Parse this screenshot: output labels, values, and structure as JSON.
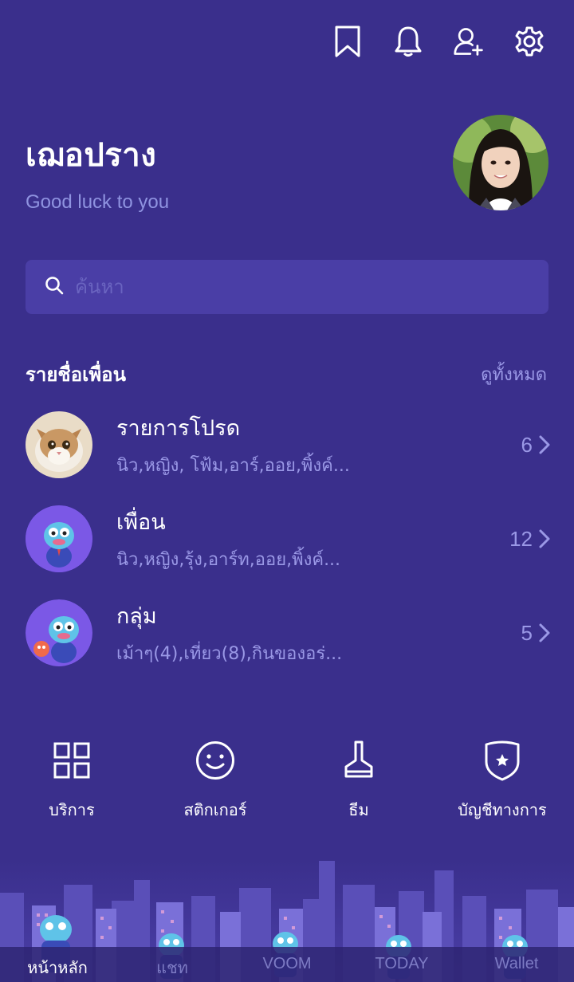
{
  "header": {
    "icons": [
      "bookmark-icon",
      "bell-icon",
      "add-friend-icon",
      "gear-icon"
    ]
  },
  "profile": {
    "name": "เฌอปราง",
    "status": "Good luck to you"
  },
  "search": {
    "placeholder": "ค้นหา"
  },
  "friends_section": {
    "title": "รายชื่อเพื่อน",
    "see_all": "ดูทั้งหมด",
    "items": [
      {
        "title": "รายการโปรด",
        "subtitle": "นิว,หญิง, โฟ้ม,อาร์,ออย,พิ้งค์...",
        "count": "6"
      },
      {
        "title": "เพื่อน",
        "subtitle": "นิว,หญิง,รุ้ง,อาร์ท,ออย,พิ้งค์...",
        "count": "12"
      },
      {
        "title": "กลุ่ม",
        "subtitle": "เม้าๆ(4),เที่ยว(8),กินของอร่...",
        "count": "5"
      }
    ]
  },
  "menu": {
    "items": [
      {
        "label": "บริการ",
        "icon": "services-grid-icon"
      },
      {
        "label": "สติกเกอร์",
        "icon": "sticker-smile-icon"
      },
      {
        "label": "ธีม",
        "icon": "theme-brush-icon"
      },
      {
        "label": "บัญชีทางการ",
        "icon": "official-account-shield-icon"
      }
    ]
  },
  "tabs": {
    "items": [
      {
        "label": "หน้าหลัก",
        "active": true
      },
      {
        "label": "แชท",
        "active": false
      },
      {
        "label": "VOOM",
        "active": false
      },
      {
        "label": "TODAY",
        "active": false
      },
      {
        "label": "Wallet",
        "active": false
      }
    ]
  },
  "colors": {
    "background": "#3a2f8c",
    "search_bg": "#4a3ea6",
    "muted_text": "#9a98e6",
    "status_text": "#8f93e0"
  }
}
